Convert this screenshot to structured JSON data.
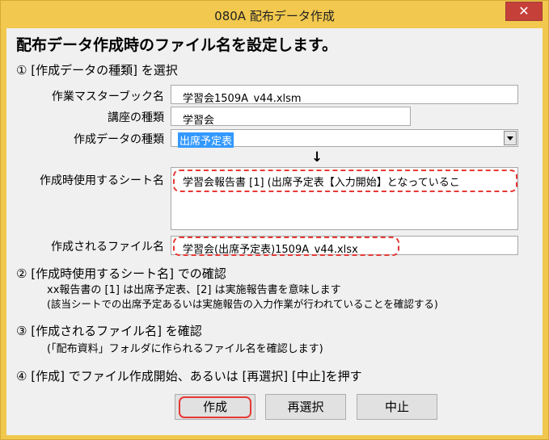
{
  "window": {
    "title": "080A 配布データ作成",
    "close_glyph": "✕"
  },
  "heading": "配布データ作成時のファイル名を設定します。",
  "step1": {
    "title": "① [作成データの種類] を選択",
    "workbook_label": "作業マスターブック名",
    "workbook_value": "学習会1509A_v44.xlsm",
    "course_label": "講座の種類",
    "course_value": "学習会",
    "datatype_label": "作成データの種類",
    "datatype_value": "出席予定表",
    "arrow": "↓",
    "sheet_label": "作成時使用するシート名",
    "sheet_value": "学習会報告書 [1] (出席予定表【入力開始】となっているこ",
    "file_label": "作成されるファイル名",
    "file_value": "学習会(出席予定表)1509A_v44.xlsx"
  },
  "step2": {
    "title": "② [作成時使用するシート名] での確認",
    "line1": "xx報告書の [1] は出席予定表、[2] は実施報告書を意味します",
    "line2": "(該当シートでの出席予定あるいは実施報告の入力作業が行われていることを確認する)"
  },
  "step3": {
    "title": "③ [作成されるファイル名] を確認",
    "line1": "(「配布資料」フォルダに作られるファイル名を確認します)"
  },
  "step4": {
    "title": "④ [作成] でファイル作成開始、あるいは [再選択] [中止]を押す"
  },
  "buttons": {
    "create": "作成",
    "reselect": "再選択",
    "cancel": "中止"
  },
  "colors": {
    "titlebar": "#f2c94e",
    "close": "#c6403a",
    "highlight": "#e53935",
    "selection": "#3399ff"
  }
}
